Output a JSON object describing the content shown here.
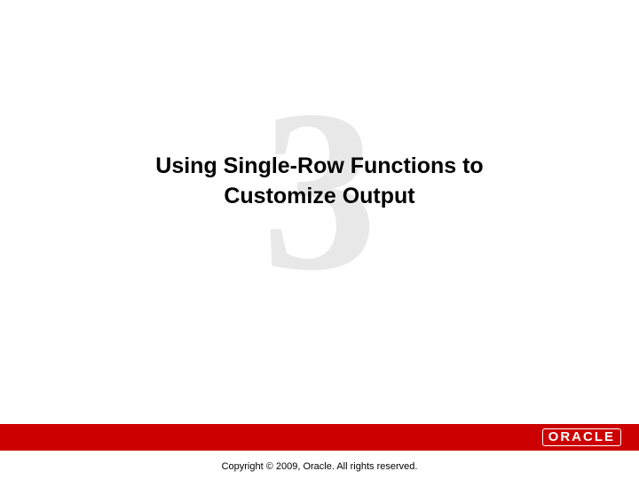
{
  "slide": {
    "chapter_number": "3",
    "title_line1": "Using Single-Row Functions to",
    "title_line2": "Customize Output"
  },
  "footer": {
    "logo_text": "ORACLE",
    "copyright": "Copyright © 2009, Oracle. All rights reserved."
  },
  "colors": {
    "footer_bar": "#cc0000",
    "background_number": "#e8e8e8"
  }
}
